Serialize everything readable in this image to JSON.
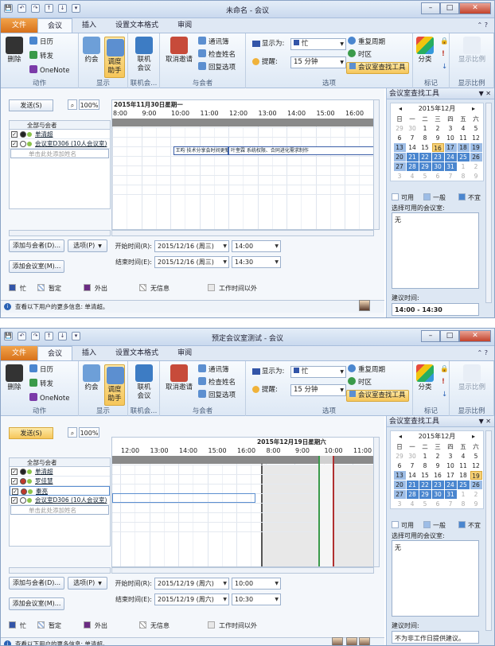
{
  "qat": [
    "💾",
    "↶",
    "↷",
    "↑",
    "↓",
    "▾"
  ],
  "ribbon": {
    "tabs": [
      "文件",
      "会议",
      "插入",
      "设置文本格式",
      "审阅"
    ],
    "groups": {
      "actions": "动作",
      "show": "显示",
      "online": "联机会...",
      "attendees": "与会者",
      "options": "选项",
      "tags": "标记",
      "zoom": "显示比例"
    },
    "delete": "删除",
    "calendar": "日历",
    "forward": "转发",
    "onenote": "OneNote",
    "appointment": "约会",
    "scheduling": "调度\n助手",
    "online_meeting": "联机\n会议",
    "cancel_invite": "取消邀请",
    "address_book": "通讯簿",
    "check_names": "检查姓名",
    "reply_options": "回复选项",
    "show_as_label": "显示为:",
    "show_as_value": "忙",
    "reminder_label": "提醒:",
    "reminder_value": "15 分钟",
    "recurrence": "重复周期",
    "timezone": "时区",
    "room_finder": "会议室查找工具",
    "categorize": "分类",
    "zoom": "显示比例"
  },
  "common": {
    "send": "发送(S)",
    "zoom_value": "100%",
    "all_attendees": "全部与会者",
    "add_name_placeholder": "单击此处添加姓名",
    "add_attendees": "添加与会者(D)...",
    "options": "选项(P)",
    "add_rooms": "添加会议室(M)...",
    "start_label": "开始时间(R):",
    "end_label": "结束时间(E):",
    "legend": [
      "忙",
      "暂定",
      "外出",
      "无信息",
      "工作时间以外"
    ],
    "status_text": "查看以下用户的更多信息: 单清超。",
    "rf_title": "会议室查找工具",
    "rf_month": "2015年12月",
    "rf_weekdays": [
      "日",
      "一",
      "二",
      "三",
      "四",
      "五",
      "六"
    ],
    "rf_legend": [
      "可用",
      "一般",
      "不宜"
    ],
    "rf_rooms_label": "选择可用的会议室:",
    "rf_rooms_value": "无",
    "rf_suggest_label": "建议时间:"
  },
  "windows": [
    {
      "title": "未命名 - 会议",
      "date_header": "2015年11月30日星期一",
      "times": [
        "8:00",
        "9:00",
        "10:00",
        "11:00",
        "12:00",
        "13:00",
        "14:00",
        "15:00",
        "16:00"
      ],
      "attendees": [
        {
          "name": "单清超",
          "type": "organizer"
        },
        {
          "name": "会议室D306 (10人会议室)",
          "type": "room"
        }
      ],
      "events": [
        {
          "text": "王昀 技术分享会时间更新",
          "start": 10.1,
          "end": 12.0
        },
        {
          "text": "叶奎霖 系统权限、合同进化需求制作",
          "start": 12.0,
          "end": 17.2
        }
      ],
      "start_date": "2015/12/16 (周三)",
      "start_time": "14:00",
      "end_date": "2015/12/16 (周三)",
      "end_time": "14:30",
      "cal_days": [
        [
          "29",
          "30",
          "1",
          "2",
          "3",
          "4",
          "5"
        ],
        [
          "6",
          "7",
          "8",
          "9",
          "10",
          "11",
          "12"
        ],
        [
          "13",
          "14",
          "15",
          "16",
          "17",
          "18",
          "19"
        ],
        [
          "20",
          "21",
          "22",
          "23",
          "24",
          "25",
          "26"
        ],
        [
          "27",
          "28",
          "29",
          "30",
          "31",
          "1",
          "2"
        ],
        [
          "3",
          "4",
          "5",
          "6",
          "7",
          "8",
          "9"
        ]
      ],
      "today": "16",
      "suggest_value": "14:00 - 14:30"
    },
    {
      "title": "预定会议室测试 - 会议",
      "date_header": "2015年12月19日星期六",
      "times": [
        "12:00",
        "13:00",
        "14:00",
        "15:00",
        "16:00",
        "8:00",
        "9:00",
        "10:00",
        "11:00"
      ],
      "attendees": [
        {
          "name": "单清超",
          "type": "organizer"
        },
        {
          "name": "罗佳慧",
          "type": "required"
        },
        {
          "name": "秦亮",
          "type": "required"
        },
        {
          "name": "会议室D306 (10人会议室)",
          "type": "room"
        }
      ],
      "events": [],
      "start_date": "2015/12/19 (周六)",
      "start_time": "10:00",
      "end_date": "2015/12/19 (周六)",
      "end_time": "10:30",
      "cal_days": [
        [
          "29",
          "30",
          "1",
          "2",
          "3",
          "4",
          "5"
        ],
        [
          "6",
          "7",
          "8",
          "9",
          "10",
          "11",
          "12"
        ],
        [
          "13",
          "14",
          "15",
          "16",
          "17",
          "18",
          "19"
        ],
        [
          "20",
          "21",
          "22",
          "23",
          "24",
          "25",
          "26"
        ],
        [
          "27",
          "28",
          "29",
          "30",
          "31",
          "1",
          "2"
        ],
        [
          "3",
          "4",
          "5",
          "6",
          "7",
          "8",
          "9"
        ]
      ],
      "today": "19",
      "suggest_value": "不为非工作日提供建议。"
    }
  ],
  "colors": {
    "busy": "#3355a8",
    "tentative": "#9bb7e0",
    "oof": "#6b2c83",
    "noinfo": "#ffffff",
    "outside": "#e8e8e8",
    "accent": "#f6c65a"
  }
}
